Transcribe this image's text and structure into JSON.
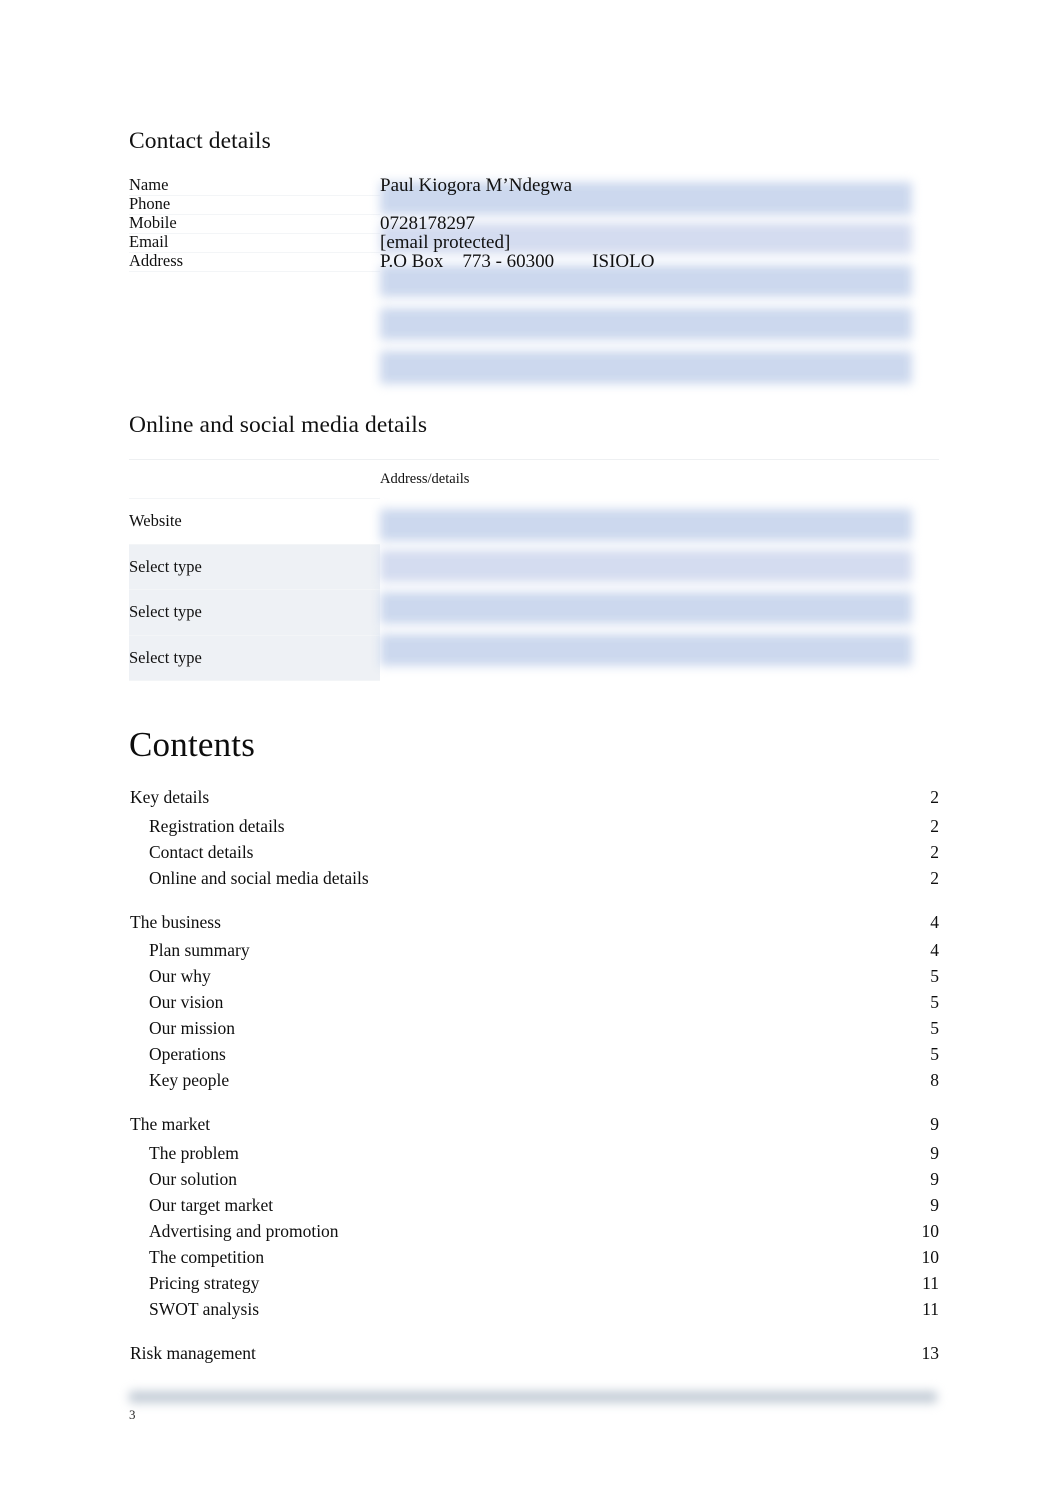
{
  "document": {
    "page_number": "3"
  },
  "contact_section": {
    "heading": "Contact details",
    "rows": [
      {
        "label": "Name",
        "value": "Paul Kiogora M’Ndegwa"
      },
      {
        "label": "Phone",
        "value": ""
      },
      {
        "label": "Mobile",
        "value": "0728178297"
      },
      {
        "label": "Email",
        "value": "[email protected]"
      },
      {
        "label": "Address",
        "value": "P.O Box    773 - 60300        ISIOLO"
      }
    ]
  },
  "online_section": {
    "heading": "Online and social media details",
    "header": {
      "label": "",
      "value": "Address/details"
    },
    "rows": [
      {
        "label": "Website",
        "value": "",
        "shaded": false
      },
      {
        "label": "Select type",
        "value": "",
        "shaded": true
      },
      {
        "label": "Select type",
        "value": "",
        "shaded": true
      },
      {
        "label": "Select type",
        "value": "",
        "shaded": true
      }
    ]
  },
  "contents_section": {
    "heading": "Contents",
    "groups": [
      {
        "top": {
          "label": "Key details",
          "page": "2"
        },
        "children": [
          {
            "label": "Registration details",
            "page": "2"
          },
          {
            "label": "Contact details",
            "page": "2"
          },
          {
            "label": "Online and social media details",
            "page": "2"
          }
        ]
      },
      {
        "top": {
          "label": "The business",
          "page": "4"
        },
        "children": [
          {
            "label": "Plan summary",
            "page": "4"
          },
          {
            "label": "Our why",
            "page": "5"
          },
          {
            "label": "Our vision",
            "page": "5"
          },
          {
            "label": "Our mission",
            "page": "5"
          },
          {
            "label": "Operations",
            "page": "5"
          },
          {
            "label": "Key people",
            "page": "8"
          }
        ]
      },
      {
        "top": {
          "label": "The market",
          "page": "9"
        },
        "children": [
          {
            "label": "The problem",
            "page": "9"
          },
          {
            "label": "Our solution",
            "page": "9"
          },
          {
            "label": "Our target market",
            "page": "9"
          },
          {
            "label": "Advertising and promotion",
            "page": "10"
          },
          {
            "label": "The competition",
            "page": "10"
          },
          {
            "label": "Pricing strategy",
            "page": "11"
          },
          {
            "label": "SWOT analysis",
            "page": "11"
          }
        ]
      },
      {
        "top": {
          "label": "Risk management",
          "page": "13"
        },
        "children": []
      }
    ]
  },
  "colors": {
    "highlight_band": "#ccd8ee",
    "highlight_band_soft": "#d4dcf0",
    "shaded_label_cell": "#eef1f5",
    "footer_rule": "#c3ccd6",
    "row_divider": "#f3f5f7",
    "text": "#111111"
  }
}
